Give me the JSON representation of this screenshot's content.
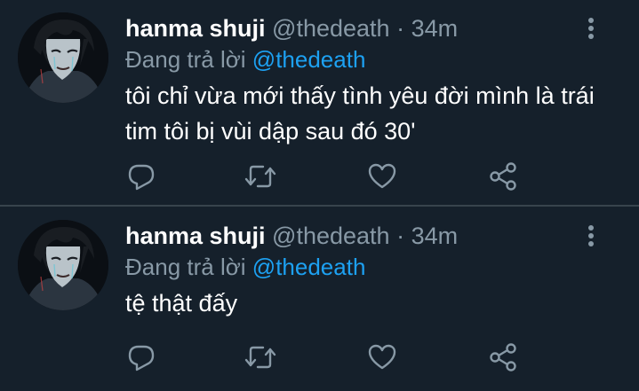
{
  "colors": {
    "background": "#15202b",
    "divider": "#38444d",
    "secondary_text": "#8899a6",
    "link": "#1da1f2",
    "primary_text": "#ffffff"
  },
  "icons": {
    "reply": "reply-icon",
    "retweet": "retweet-icon",
    "like": "heart-icon",
    "share": "share-icon",
    "more": "more-vertical-icon"
  },
  "tweets": [
    {
      "display_name": "hanma shuji",
      "handle": "@thedeath",
      "separator": "·",
      "time": "34m",
      "reply_prefix": "Đang trả lời",
      "reply_to": "@thedeath",
      "text": "tôi chỉ vừa mới thấy tình yêu đời mình là trái tim tôi bị vùi dập sau đó 30'"
    },
    {
      "display_name": "hanma shuji",
      "handle": "@thedeath",
      "separator": "·",
      "time": "34m",
      "reply_prefix": "Đang trả lời",
      "reply_to": "@thedeath",
      "text": "tệ thật đấy"
    }
  ]
}
